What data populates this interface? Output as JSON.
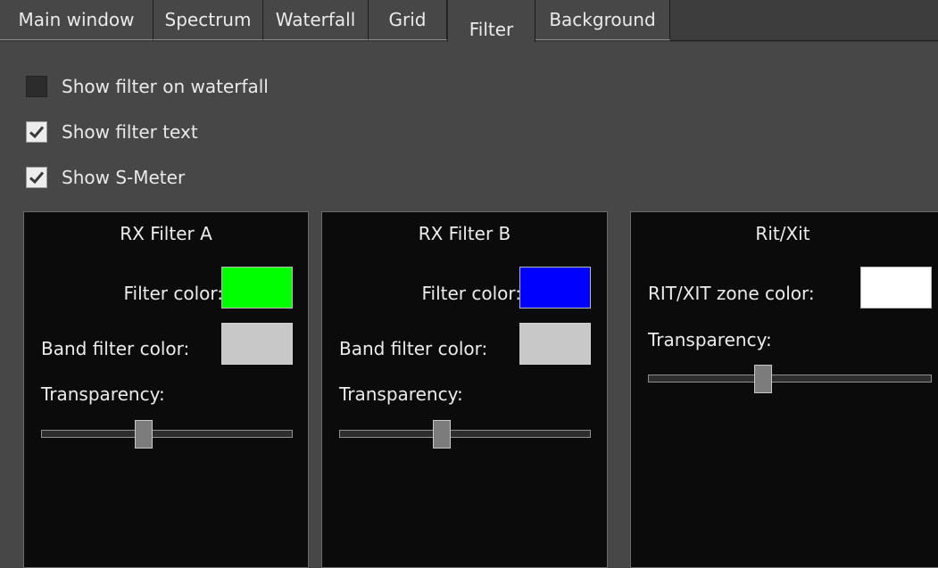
{
  "tabs": [
    {
      "label": "Main window"
    },
    {
      "label": "Spectrum"
    },
    {
      "label": "Waterfall"
    },
    {
      "label": "Grid"
    },
    {
      "label": "Filter",
      "active": true
    },
    {
      "label": "Background"
    }
  ],
  "options": {
    "show_filter_waterfall": {
      "label": "Show filter on waterfall",
      "checked": false
    },
    "show_filter_text": {
      "label": "Show filter text",
      "checked": true
    },
    "show_smeter": {
      "label": "Show S-Meter",
      "checked": true
    }
  },
  "rx_filter_a": {
    "title": "RX Filter A",
    "filter_color_label": "Filter color:",
    "filter_color": "#00ff00",
    "band_filter_color_label": "Band filter color:",
    "band_filter_color": "#c8c8c8",
    "transparency_label": "Transparency:",
    "transparency_fraction": 0.4
  },
  "rx_filter_b": {
    "title": "RX Filter B",
    "filter_color_label": "Filter color:",
    "filter_color": "#0000ff",
    "band_filter_color_label": "Band filter color:",
    "band_filter_color": "#c8c8c8",
    "transparency_label": "Transparency:",
    "transparency_fraction": 0.4
  },
  "rit_xit": {
    "title": "Rit/Xit",
    "zone_color_label": "RIT/XIT zone color:",
    "zone_color": "#ffffff",
    "transparency_label": "Transparency:",
    "transparency_fraction": 0.4
  }
}
